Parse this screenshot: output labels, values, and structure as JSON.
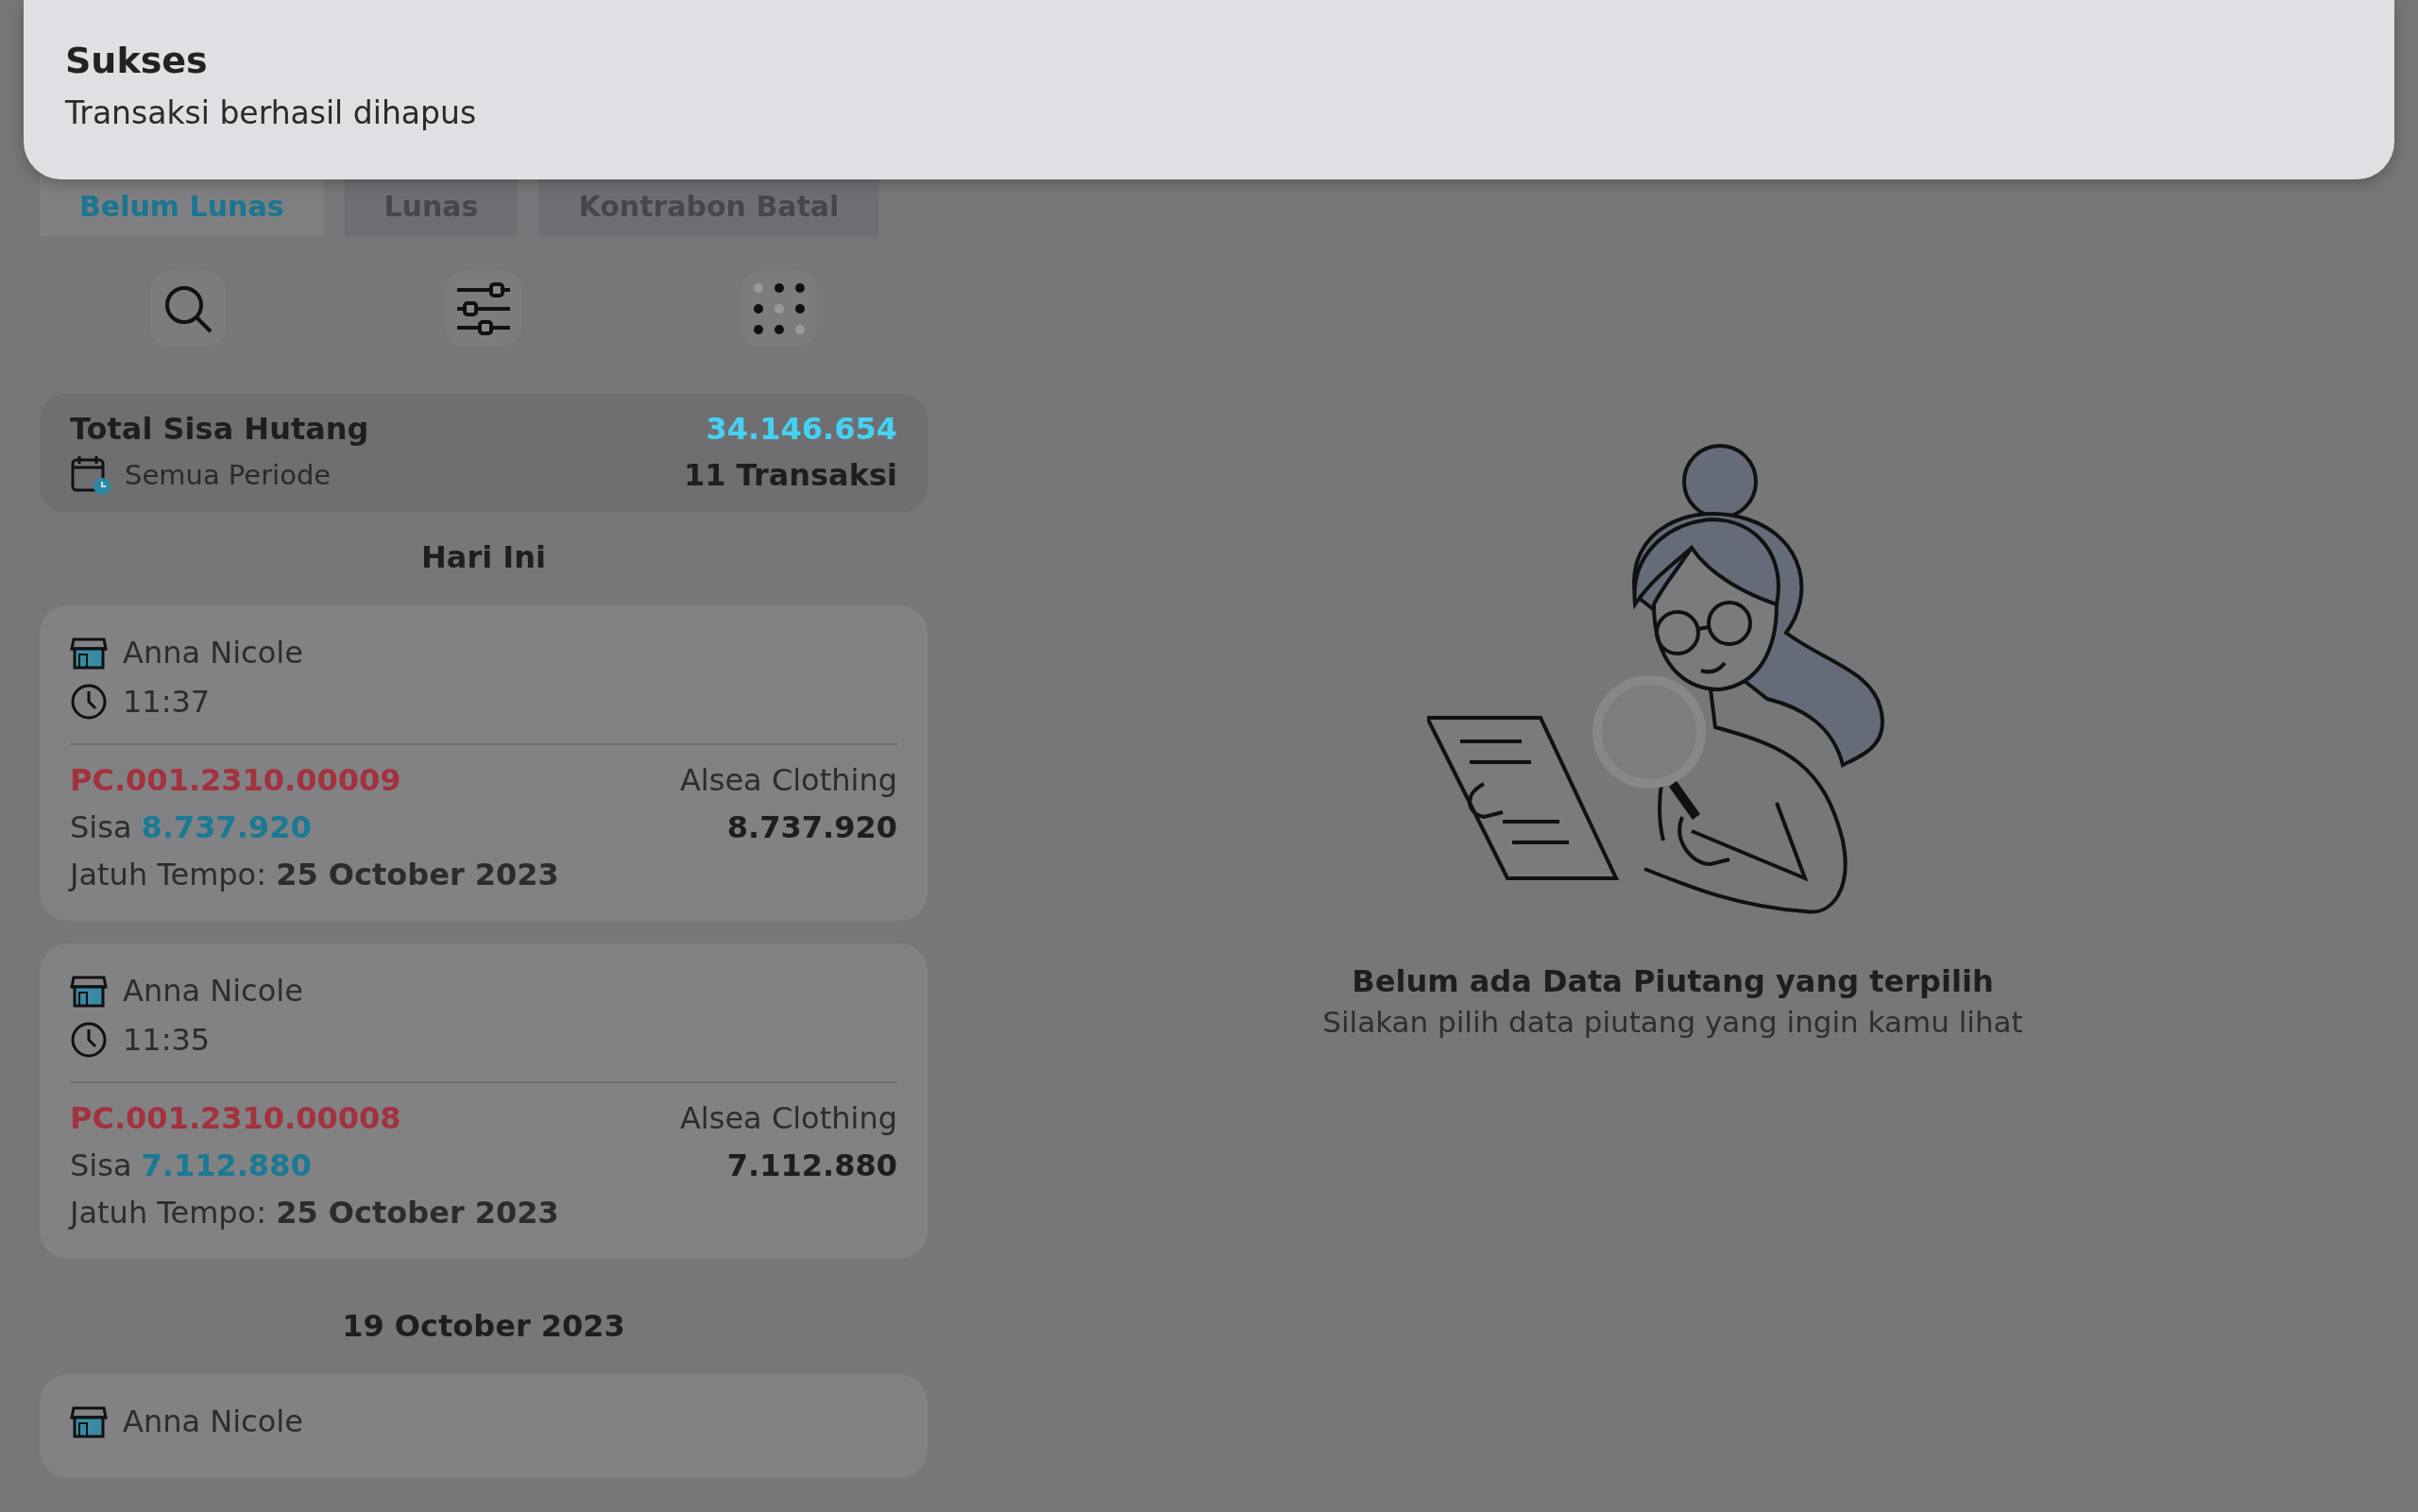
{
  "toast": {
    "title": "Sukses",
    "message": "Transaksi berhasil dihapus"
  },
  "tabs": [
    {
      "label": "Belum Lunas",
      "selected": true
    },
    {
      "label": "Lunas",
      "selected": false
    },
    {
      "label": "Kontrabon Batal",
      "selected": false
    }
  ],
  "summary": {
    "label": "Total Sisa Hutang",
    "amount": "34.146.654",
    "period": "Semua Periode",
    "count": "11 Transaksi"
  },
  "groups": [
    {
      "date": "Hari Ini",
      "transactions": [
        {
          "customer": "Anna Nicole",
          "time": "11:37",
          "number": "PC.001.2310.00009",
          "supplier": "Alsea Clothing",
          "sisa_label": "Sisa",
          "sisa_amount": "8.737.920",
          "amount": "8.737.920",
          "due": "Jatuh Tempo: **25 October 2023**"
        },
        {
          "customer": "Anna Nicole",
          "time": "11:35",
          "number": "PC.001.2310.00008",
          "supplier": "Alsea Clothing",
          "sisa_label": "Sisa",
          "sisa_amount": "7.112.880",
          "amount": "7.112.880",
          "due": "Jatuh Tempo: **25 October 2023**"
        }
      ]
    },
    {
      "date": "19 October 2023",
      "transactions": [
        {
          "customer": "Anna Nicole"
        }
      ]
    }
  ],
  "empty_state": {
    "title": "Belum ada Data Piutang yang terpilih",
    "message": "Silakan pilih data piutang yang ingin kamu lihat"
  }
}
